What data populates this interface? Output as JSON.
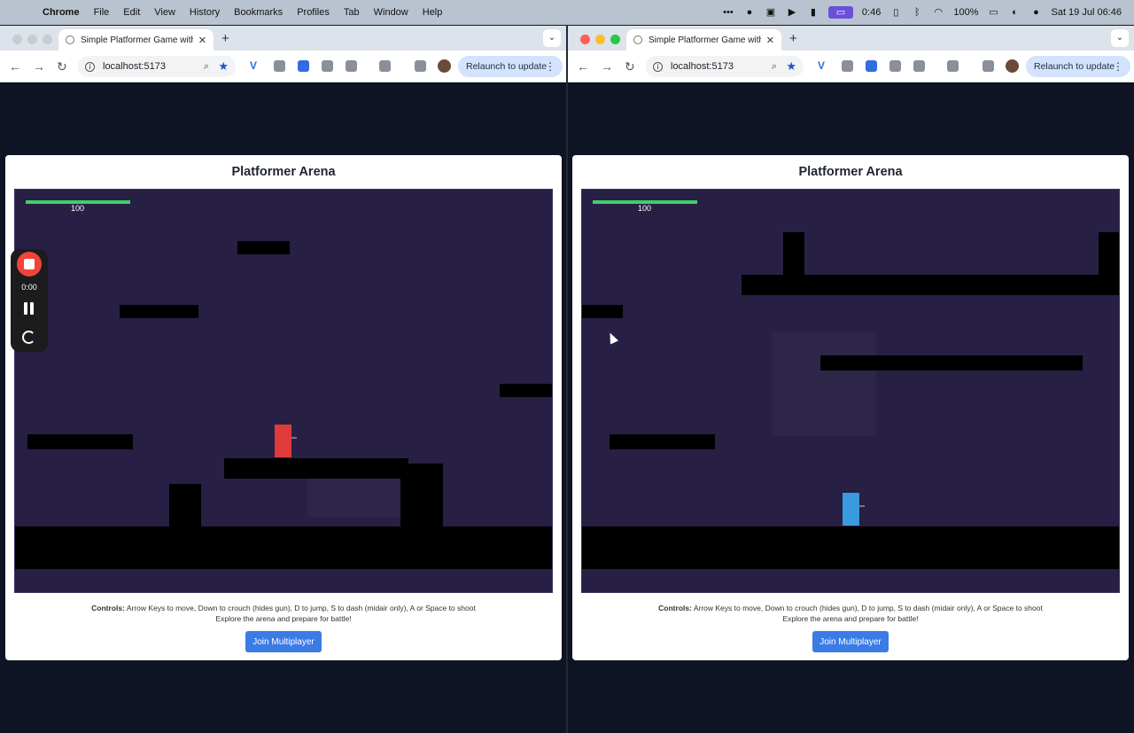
{
  "menubar": {
    "app": "Chrome",
    "items": [
      "File",
      "Edit",
      "View",
      "History",
      "Bookmarks",
      "Profiles",
      "Tab",
      "Window",
      "Help"
    ],
    "timer": "0:46",
    "battery": "100%",
    "datetime": "Sat 19 Jul  06:46"
  },
  "browser": {
    "tab_title": "Simple Platformer Game with",
    "url": "localhost:5173",
    "relaunch_label": "Relaunch to update"
  },
  "game": {
    "title": "Platformer Arena",
    "health": "100",
    "controls_label": "Controls:",
    "controls_text": " Arrow Keys to move, Down to crouch (hides gun), D to jump, S to dash (midair only), A or Space to shoot",
    "hint": "Explore the arena and prepare for battle!",
    "join_label": "Join Multiplayer"
  },
  "recorder": {
    "elapsed": "0:00"
  },
  "icons": {
    "colors": {
      "player_left": "#e03a3a",
      "player_right": "#3a9ae0",
      "health": "#3fcf6a",
      "arena": "#281f44",
      "join": "#3b7be6"
    }
  }
}
